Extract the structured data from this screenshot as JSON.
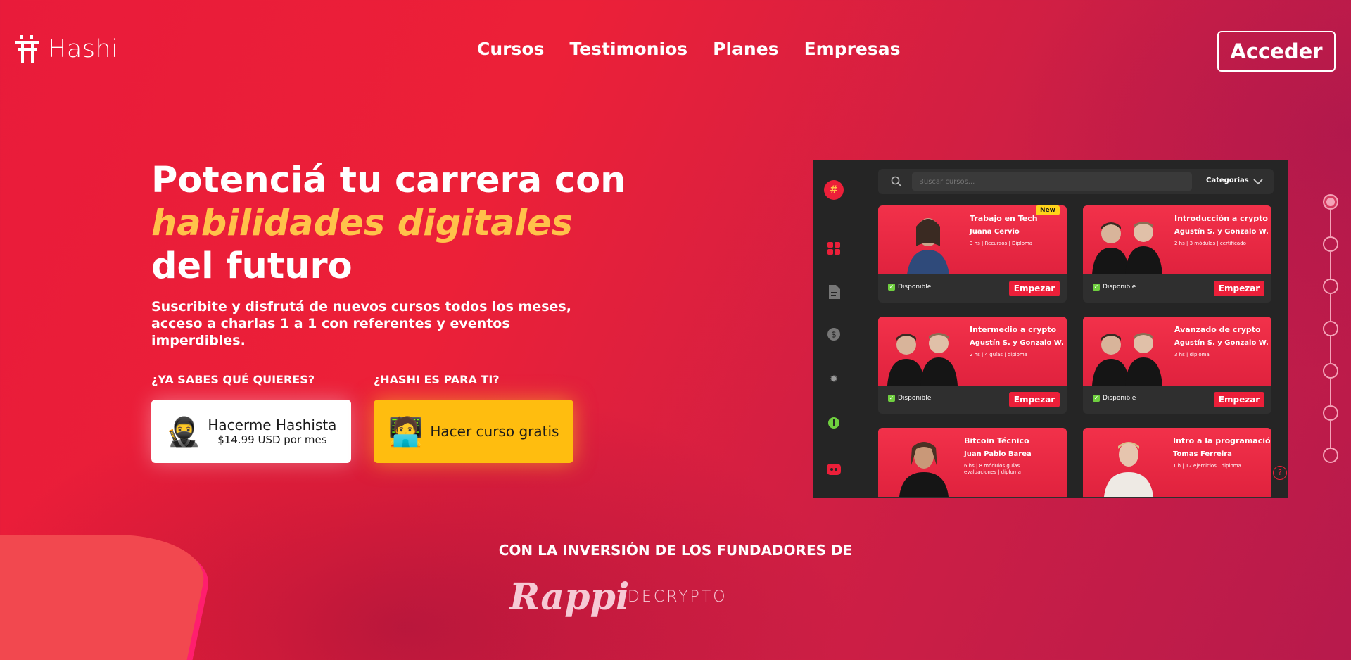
{
  "brand": {
    "name": "Hashi"
  },
  "nav": {
    "items": [
      "Cursos",
      "Testimonios",
      "Planes",
      "Empresas"
    ],
    "login_label": "Acceder"
  },
  "hero": {
    "headline_part1": "Potenciá tu carrera con",
    "headline_highlight": "habilidades digitales",
    "headline_part2": "del futuro",
    "subtitle": "Suscribite y disfrutá de nuevos cursos todos los meses, acceso a charlas 1 a 1 con referentes y eventos imperdibles.",
    "question_left": "¿YA SABES QUÉ QUIERES?",
    "question_right": "¿HASHI ES PARA TI?",
    "cta_primary": {
      "label": "Hacerme Hashista",
      "price": "$14.99 USD por mes",
      "emoji": "🥷"
    },
    "cta_secondary": {
      "label": "Hacer curso gratis",
      "emoji": "🧑‍💻"
    }
  },
  "mockup": {
    "search_placeholder": "Buscar cursos...",
    "categories_label": "Categorias",
    "available_label": "Disponible",
    "start_label": "Empezar",
    "new_badge": "New",
    "courses": [
      {
        "title": "Trabajo en Tech",
        "author": "Juana Cervio",
        "meta": "3 hs | Recursos | Diploma"
      },
      {
        "title": "Introducción a crypto",
        "author": "Agustín S. y Gonzalo W.",
        "meta": "2 hs | 3 módulos | certificado"
      },
      {
        "title": "Intermedio a crypto",
        "author": "Agustín S. y Gonzalo W.",
        "meta": "2 hs | 4 guías | diploma"
      },
      {
        "title": "Avanzado de crypto",
        "author": "Agustín S. y Gonzalo W.",
        "meta": "3 hs | diploma"
      },
      {
        "title": "Bitcoin Técnico",
        "author": "Juan Pablo Barea",
        "meta": "6 hs | 8 módulos guías | evaluaciones | diploma"
      },
      {
        "title": "Intro a la programación",
        "author": "Tomas Ferreira",
        "meta": "1 h | 12 ejercicios | diploma"
      }
    ]
  },
  "investors": {
    "title": "CON LA INVERSIÓN DE LOS FUNDADORES DE",
    "logos": [
      "Rappi",
      "DECRYPTO"
    ]
  },
  "colors": {
    "accent_yellow": "#ffbd0f",
    "highlight": "#ffc24a",
    "brand_red": "#ec1f39"
  }
}
